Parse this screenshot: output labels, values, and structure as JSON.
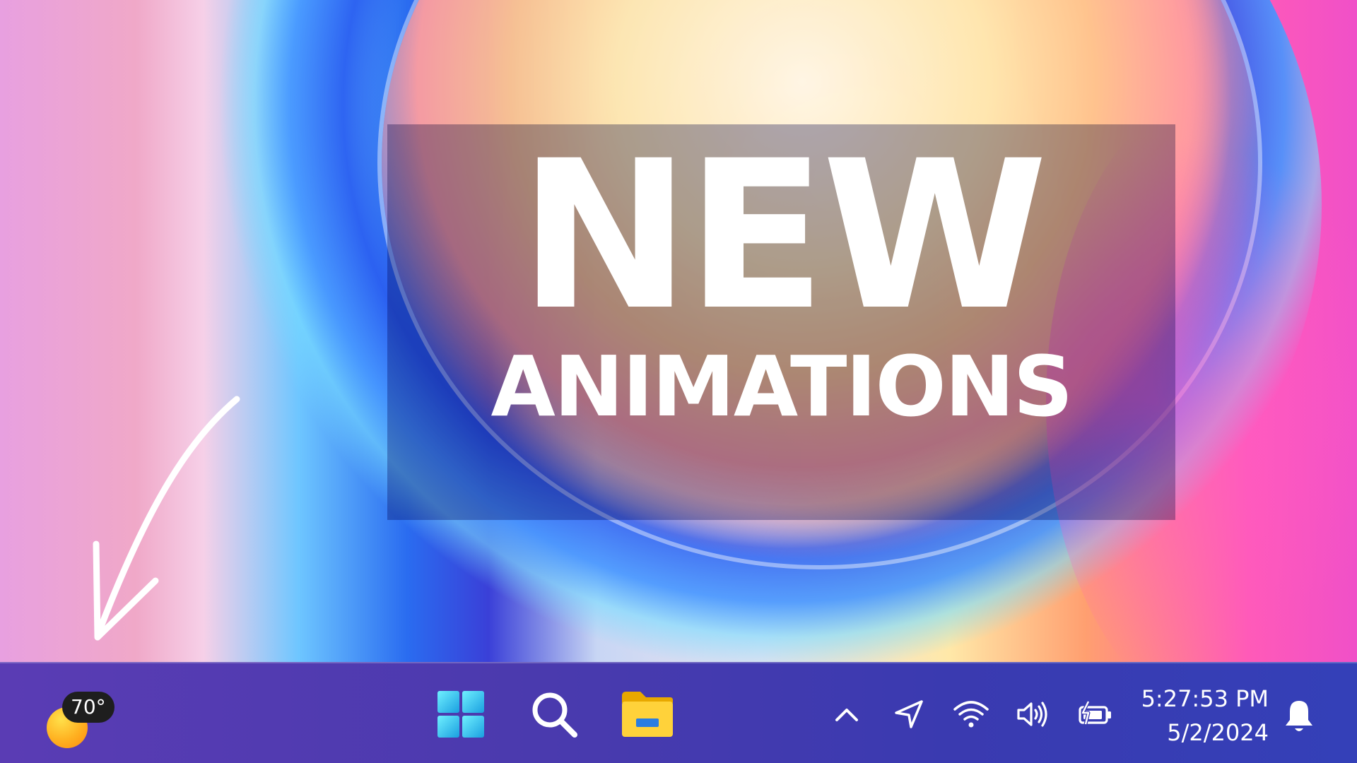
{
  "wallpaper": {
    "title_line1": "NEW",
    "title_line2": "ANIMATIONS"
  },
  "taskbar": {
    "weather": {
      "temperature": "70°",
      "icon": "sun-icon"
    },
    "pinned": [
      {
        "icon": "windows-start-icon",
        "color": "#38c8f0"
      },
      {
        "icon": "search-icon",
        "color": "#ffffff"
      },
      {
        "icon": "file-explorer-icon",
        "color": "#ffd23a"
      }
    ],
    "tray": [
      "chevron-up-icon",
      "location-icon",
      "wifi-icon",
      "volume-icon",
      "battery-charging-icon"
    ],
    "clock": {
      "time": "5:27:53 PM",
      "date": "5/2/2024"
    },
    "notifications_icon": "bell-icon"
  }
}
